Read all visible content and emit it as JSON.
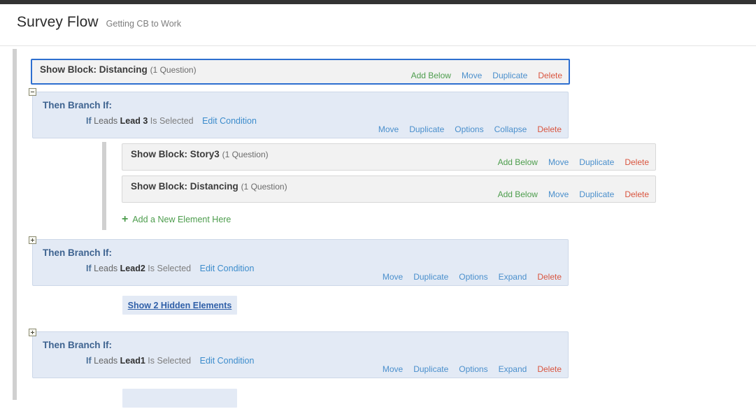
{
  "header": {
    "title": "Survey Flow",
    "subtitle": "Getting CB to Work"
  },
  "labels": {
    "add_below": "Add Below",
    "move": "Move",
    "duplicate": "Duplicate",
    "delete": "Delete",
    "options": "Options",
    "collapse": "Collapse",
    "expand": "Expand",
    "edit_condition": "Edit Condition",
    "add_new_element": "Add a New Element Here",
    "show_hidden": "Show 2 Hidden Elements",
    "plus_icon": "+"
  },
  "colors": {
    "link_blue": "#4a8fcc",
    "link_green": "#4d9d4d",
    "link_red": "#d9553f",
    "branch_bg": "#e3eaf5",
    "block_bg": "#f2f2f2",
    "selected_border": "#2e6fd0",
    "topbar": "#333333"
  },
  "flow": {
    "root_block": {
      "title": "Show Block:",
      "name": "Distancing",
      "questions": "(1 Question)",
      "selected": true
    },
    "branch1": {
      "title": "Then Branch If:",
      "if": "If",
      "field": "Leads",
      "value": "Lead 3",
      "operator": "Is Selected",
      "toggle": "minus",
      "collapse_label": "Collapse",
      "children": [
        {
          "title": "Show Block:",
          "name": "Story3",
          "questions": "(1 Question)"
        },
        {
          "title": "Show Block:",
          "name": "Distancing",
          "questions": "(1 Question)"
        }
      ]
    },
    "branch2": {
      "title": "Then Branch If:",
      "if": "If",
      "field": "Leads",
      "value": "Lead2",
      "operator": "Is Selected",
      "toggle": "plus",
      "collapse_label": "Expand"
    },
    "branch3": {
      "title": "Then Branch If:",
      "if": "If",
      "field": "Leads",
      "value": "Lead1",
      "operator": "Is Selected",
      "toggle": "plus",
      "collapse_label": "Expand"
    }
  }
}
